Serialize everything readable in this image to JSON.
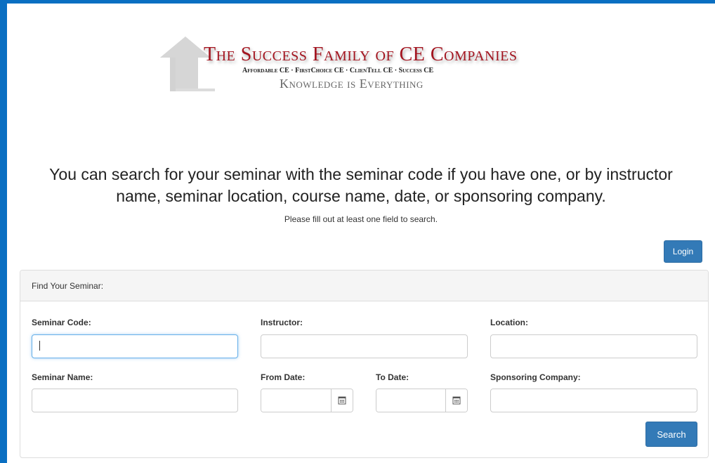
{
  "logo": {
    "title": "The Success Family of CE Companies",
    "companies": "Affordable CE · FirstChoice CE · ClienTell CE · Success CE",
    "tagline": "Knowledge is Everything"
  },
  "intro": {
    "line1": "You can search for your seminar with the seminar code if you have one, or by instructor",
    "line2": "name, seminar location, course name, date, or sponsoring company.",
    "hint": "Please fill out at least one field to search."
  },
  "login_label": "Login",
  "panel": {
    "heading": "Find Your Seminar:",
    "fields": {
      "seminar_code": {
        "label": "Seminar Code:",
        "value": ""
      },
      "instructor": {
        "label": "Instructor:",
        "value": ""
      },
      "location": {
        "label": "Location:",
        "value": ""
      },
      "seminar_name": {
        "label": "Seminar Name:",
        "value": ""
      },
      "from_date": {
        "label": "From Date:",
        "value": ""
      },
      "to_date": {
        "label": "To Date:",
        "value": ""
      },
      "sponsoring_company": {
        "label": "Sponsoring Company:",
        "value": ""
      }
    },
    "search_label": "Search"
  },
  "colors": {
    "frame": "#0a6fc2",
    "brand_red": "#a3141f",
    "button": "#337ab7",
    "focus": "#66afe9"
  },
  "icons": {
    "logo_mark": "house-arrow-icon",
    "date_picker": "calendar-icon"
  }
}
